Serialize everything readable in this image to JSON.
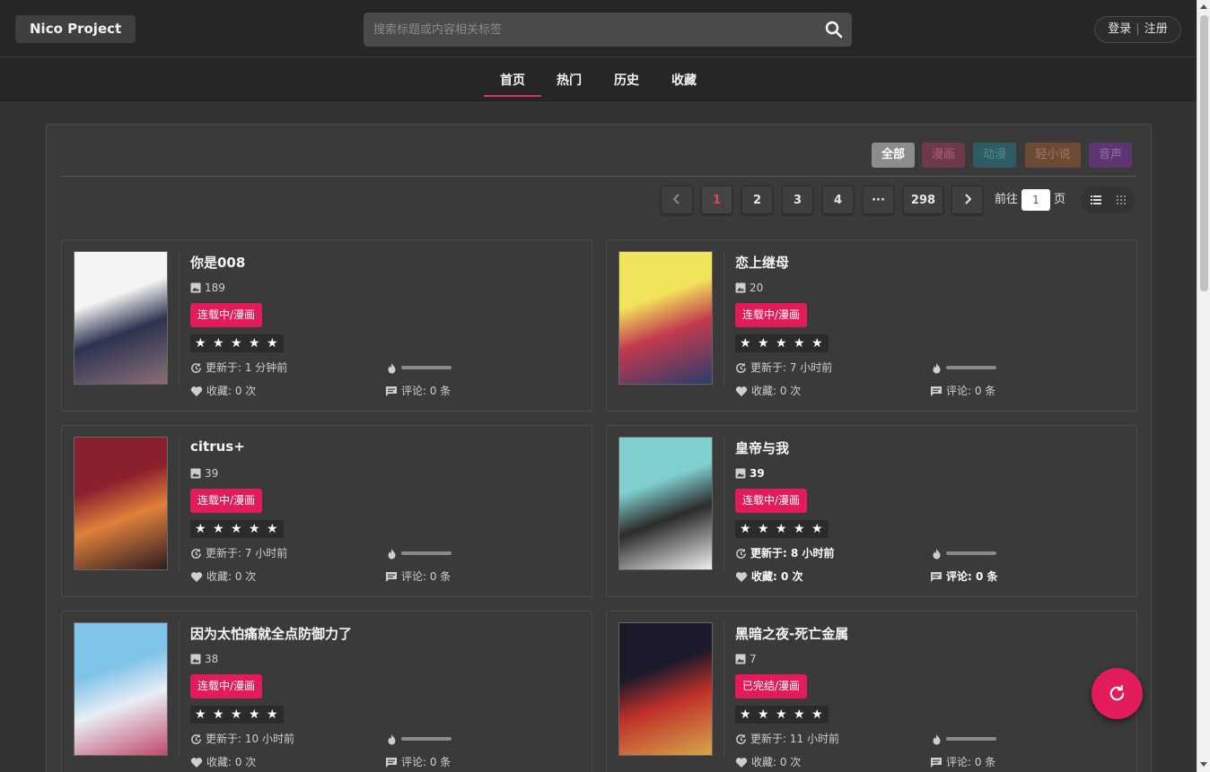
{
  "header": {
    "logo": "Nico Project",
    "search_placeholder": "搜索标题或内容相关标签",
    "login": "登录",
    "separator": "|",
    "register": "注册"
  },
  "nav": {
    "items": [
      {
        "label": "首页",
        "active": true
      },
      {
        "label": "热门",
        "active": false
      },
      {
        "label": "历史",
        "active": false
      },
      {
        "label": "收藏",
        "active": false
      }
    ]
  },
  "filters": [
    {
      "label": "全部",
      "bg": "#8c8c8c",
      "color": "#ffffff"
    },
    {
      "label": "漫画",
      "bg": "#6e3a4a",
      "color": "#b55d78"
    },
    {
      "label": "动漫",
      "bg": "#2f5c63",
      "color": "#4f8d96"
    },
    {
      "label": "轻小说",
      "bg": "#6b4b36",
      "color": "#a87855"
    },
    {
      "label": "音声",
      "bg": "#5c3670",
      "color": "#9a68b3"
    }
  ],
  "pagination": {
    "prev": "‹",
    "pages": [
      "1",
      "2",
      "3",
      "4",
      "···",
      "298"
    ],
    "next": "›",
    "current": "1",
    "goto_prefix": "前往",
    "goto_value": "1",
    "goto_suffix": "页"
  },
  "cards": [
    {
      "title": "你是008",
      "pages": "189",
      "tag": "连载中/漫画",
      "updated": "更新于: 1 分钟前",
      "favorites": "收藏: 0 次",
      "comments": "评论: 0 条",
      "cover_colors": [
        "#f4f4f4",
        "#2c3350",
        "#8a6e78"
      ]
    },
    {
      "title": "恋上继母",
      "pages": "20",
      "tag": "连载中/漫画",
      "updated": "更新于: 7 小时前",
      "favorites": "收藏: 0 次",
      "comments": "评论: 0 条",
      "cover_colors": [
        "#f2e45a",
        "#c23a4e",
        "#2b3d6b"
      ]
    },
    {
      "title": "citrus+",
      "pages": "39",
      "tag": "连载中/漫画",
      "updated": "更新于: 7 小时前",
      "favorites": "收藏: 0 次",
      "comments": "评论: 0 条",
      "cover_colors": [
        "#8a1f2e",
        "#e0803a",
        "#2a1c22"
      ]
    },
    {
      "title": "皇帝与我",
      "pages": "39",
      "tag": "连载中/漫画",
      "updated": "更新于: 8 小时前",
      "favorites": "收藏: 0 次",
      "comments": "评论: 0 条",
      "cover_colors": [
        "#7fcfcf",
        "#2b2b2b",
        "#f0f0f0"
      ]
    },
    {
      "title": "因为太怕痛就全点防御力了",
      "pages": "38",
      "tag": "连载中/漫画",
      "updated": "更新于: 10 小时前",
      "favorites": "收藏: 0 次",
      "comments": "评论: 0 条",
      "cover_colors": [
        "#7ec3e8",
        "#e8eef6",
        "#c04a6a"
      ]
    },
    {
      "title": "黑暗之夜-死亡金属",
      "pages": "7",
      "tag": "已完结/漫画",
      "updated": "更新于: 11 小时前",
      "favorites": "收藏: 0 次",
      "comments": "评论: 0 条",
      "cover_colors": [
        "#1a1a2a",
        "#c0302a",
        "#d4a84a"
      ]
    }
  ],
  "stars": "★★★★★",
  "accent_color": "#e21c5a"
}
